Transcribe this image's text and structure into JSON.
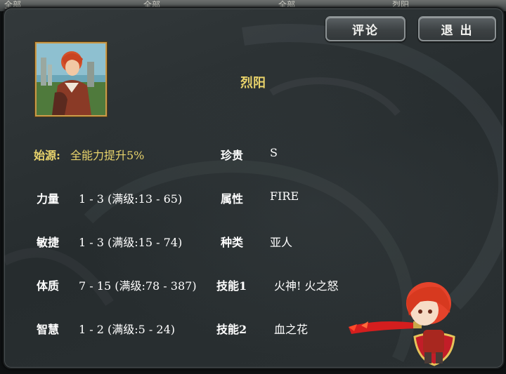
{
  "top_tabs": [
    "全部",
    "全部",
    "全部",
    "烈阳"
  ],
  "buttons": {
    "comment": "评论",
    "exit": "退 出"
  },
  "hero": {
    "name": "烈阳",
    "origin_label": "始源:",
    "origin_value": "全能力提升5%"
  },
  "stats": [
    {
      "label": "力量",
      "value": "1 - 3 (满级:13 - 65)"
    },
    {
      "label": "敏捷",
      "value": "1 - 3 (满级:15 - 74)"
    },
    {
      "label": "体质",
      "value": "7 - 15 (满级:78 - 387)"
    },
    {
      "label": "智慧",
      "value": "1 - 2 (满级:5 - 24)"
    }
  ],
  "attributes": [
    {
      "label": "珍贵",
      "value": "S"
    },
    {
      "label": "属性",
      "value": "FIRE"
    },
    {
      "label": "种类",
      "value": "亚人"
    },
    {
      "label": "技能1",
      "value": "火神! 火之怒"
    },
    {
      "label": "技能2",
      "value": "血之花"
    }
  ],
  "colors": {
    "accent_gold": "#e8d26a",
    "panel": "#2b3133",
    "text": "#ffffff"
  }
}
